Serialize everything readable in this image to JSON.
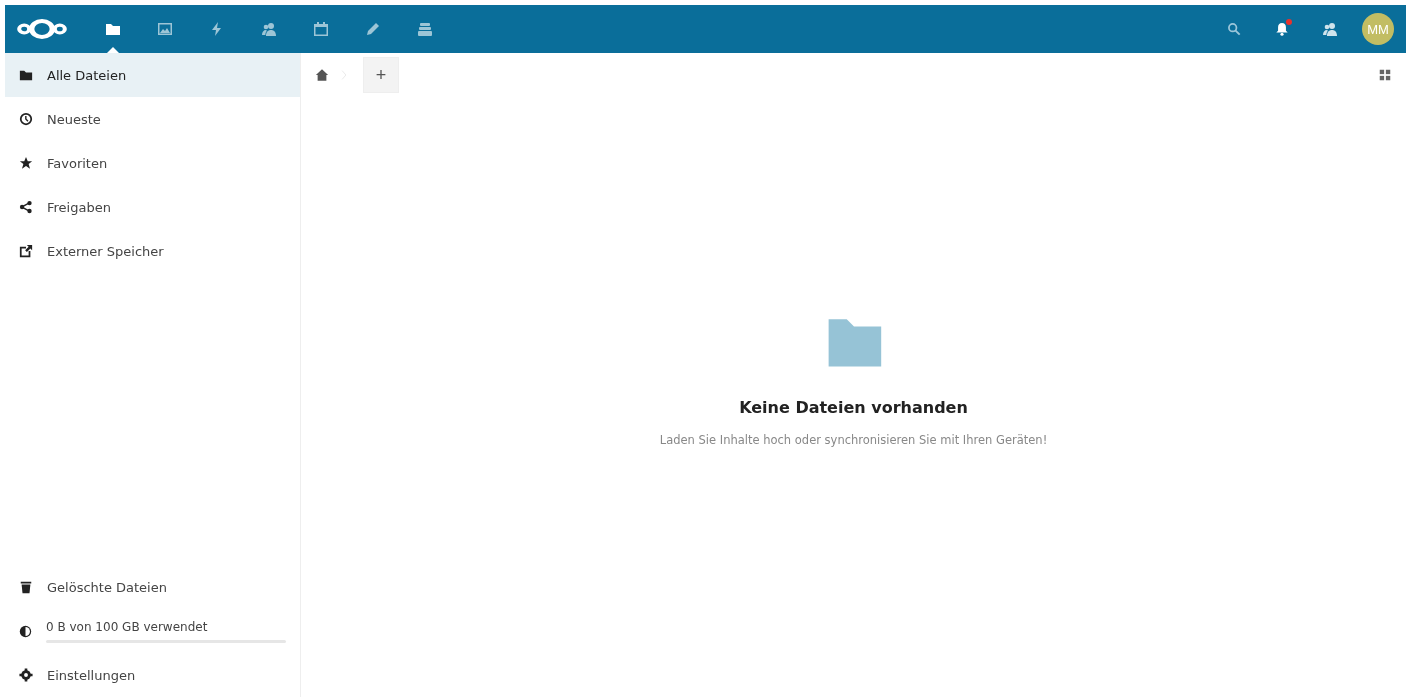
{
  "header": {
    "apps": [
      {
        "kind": "files",
        "selected": true
      },
      {
        "kind": "gallery",
        "selected": false
      },
      {
        "kind": "activity",
        "selected": false
      },
      {
        "kind": "contacts",
        "selected": false
      },
      {
        "kind": "calendar",
        "selected": false
      },
      {
        "kind": "notes",
        "selected": false
      },
      {
        "kind": "deck",
        "selected": false
      }
    ],
    "notifications": {
      "unread": true
    },
    "avatar": {
      "initials": "MM"
    }
  },
  "sidebar": {
    "items": [
      {
        "kind": "folder",
        "label": "Alle Dateien",
        "selected": true
      },
      {
        "kind": "clock",
        "label": "Neueste",
        "selected": false
      },
      {
        "kind": "star",
        "label": "Favoriten",
        "selected": false
      },
      {
        "kind": "share",
        "label": "Freigaben",
        "selected": false
      },
      {
        "kind": "external",
        "label": "Externer Speicher",
        "selected": false
      }
    ],
    "footer_items": [
      {
        "kind": "trash",
        "label": "Gelöschte Dateien"
      }
    ],
    "quota": {
      "label": "0 B von 100 GB verwendet",
      "level": 0
    },
    "settings": {
      "label": "Einstellungen"
    }
  },
  "main": {
    "empty_state": {
      "title": "Keine Dateien vorhanden",
      "message": "Laden Sie Inhalte hoch oder synchronisieren Sie mit Ihren Geräten!"
    },
    "new_button": {
      "label": "+"
    }
  }
}
